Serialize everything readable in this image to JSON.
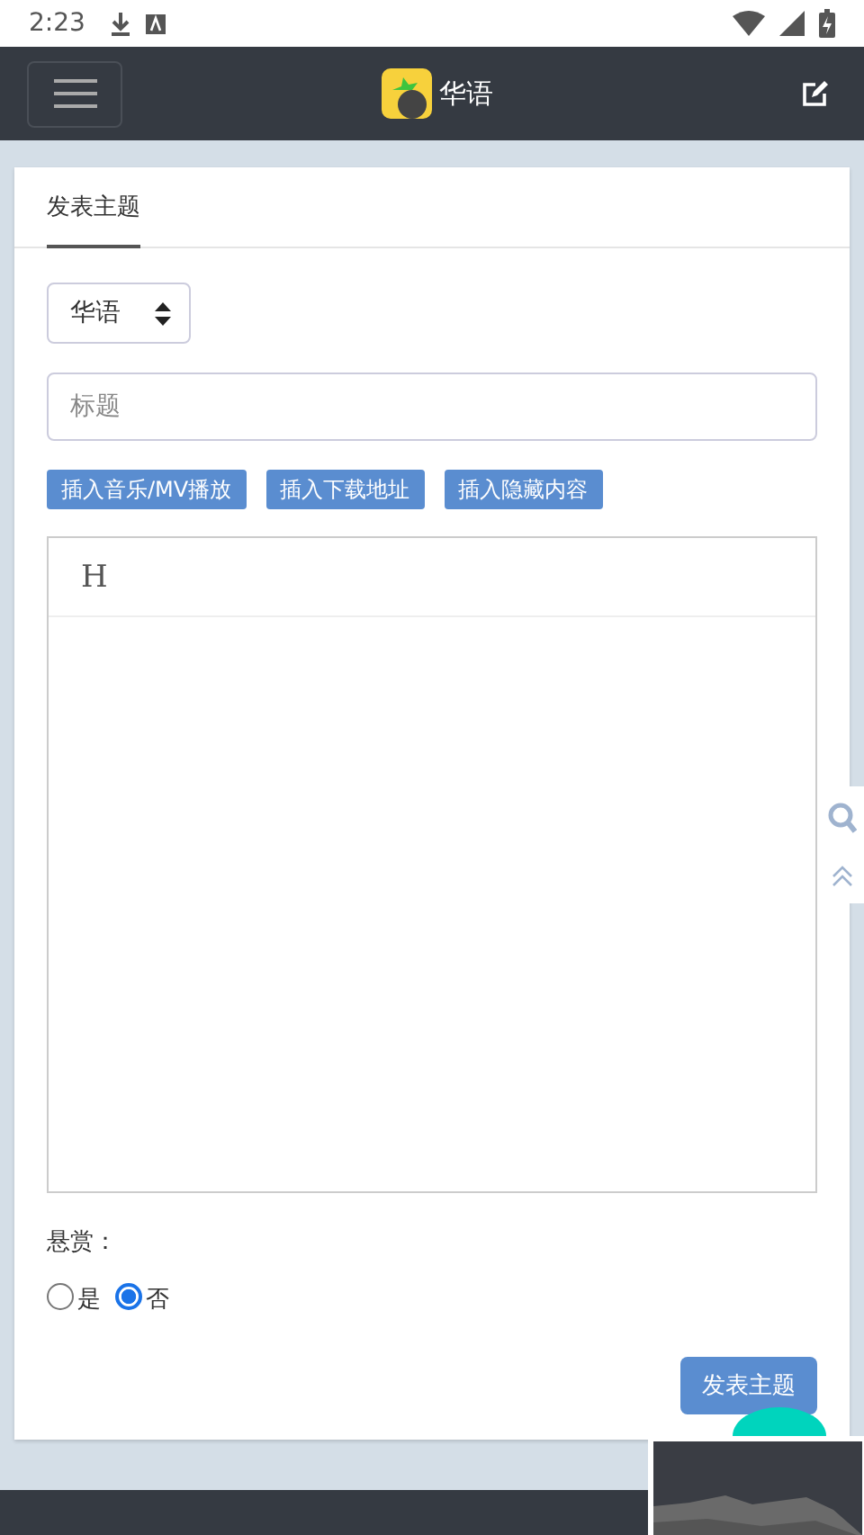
{
  "status_bar": {
    "time": "2:23"
  },
  "navbar": {
    "title": "华语"
  },
  "tabs": [
    {
      "label": "发表主题",
      "selected": true
    }
  ],
  "form": {
    "category": {
      "value": "华语"
    },
    "title_field": {
      "placeholder": "标题"
    },
    "insert_buttons": [
      "插入音乐/MV播放",
      "插入下载地址",
      "插入隐藏内容"
    ],
    "editor": {
      "toolbar": [
        "H"
      ]
    },
    "reward": {
      "label": "悬赏：",
      "options": [
        {
          "label": "是",
          "selected": false
        },
        {
          "label": "否",
          "selected": true
        }
      ]
    },
    "submit": "发表主题"
  }
}
